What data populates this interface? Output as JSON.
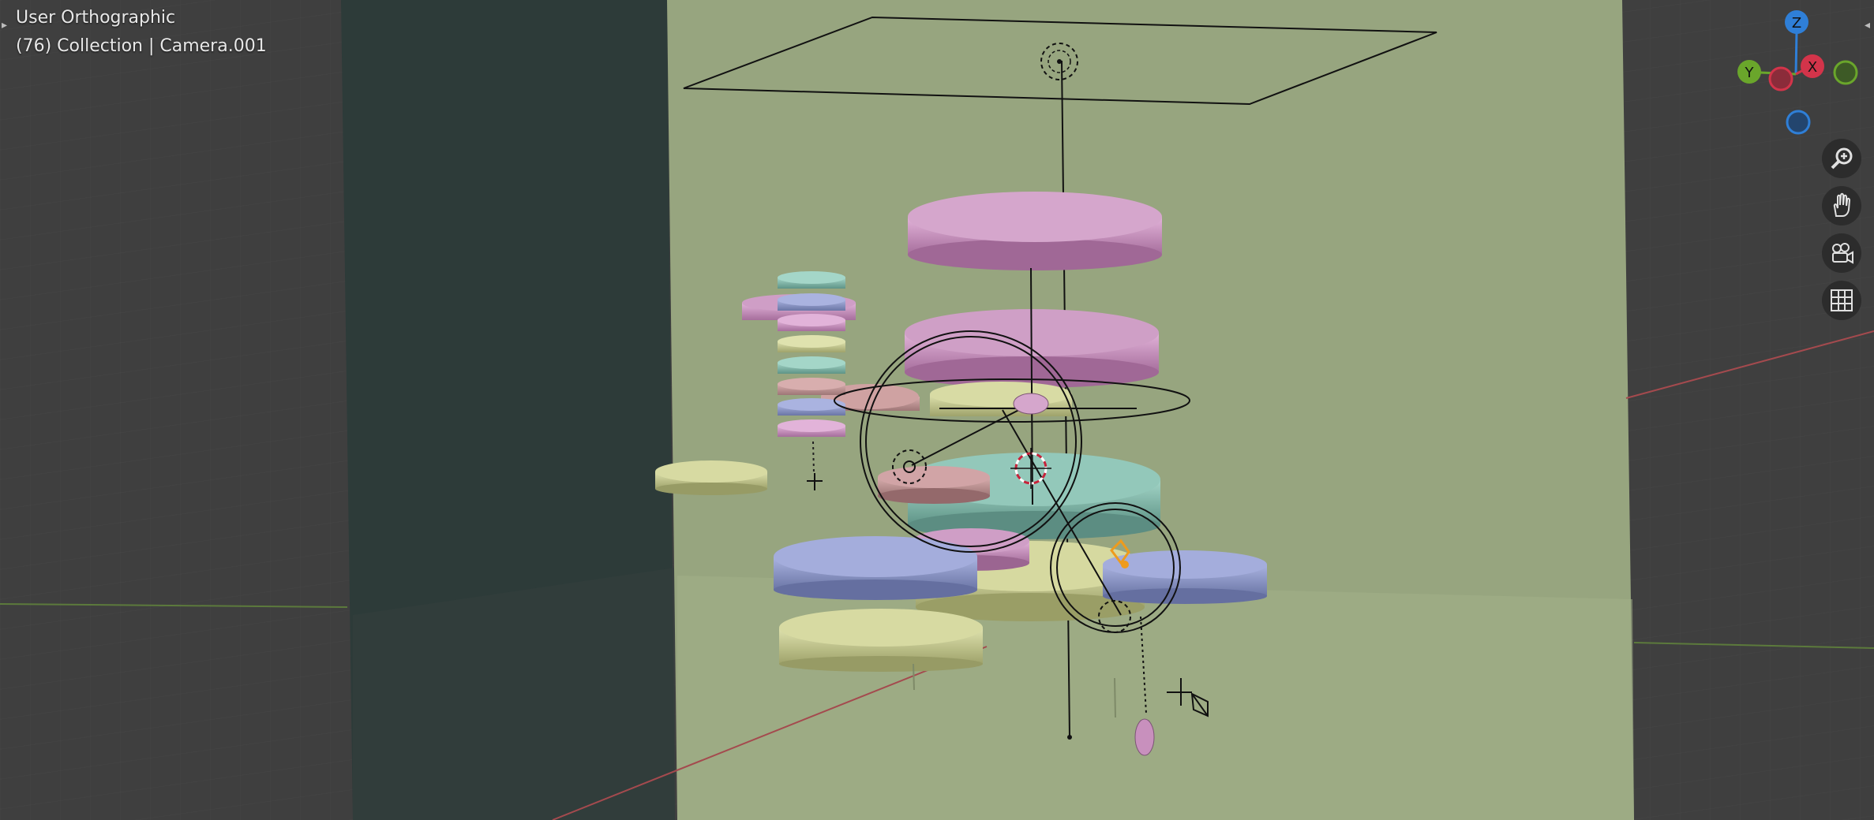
{
  "viewport": {
    "view_name": "User Orthographic",
    "collection_info": "(76) Collection | Camera.001"
  },
  "gizmo": {
    "axes": [
      {
        "label": "Z",
        "color": "#2f7fd7"
      },
      {
        "label": "Y",
        "color": "#6aa62b"
      },
      {
        "label": "X",
        "color": "#d3344a"
      }
    ]
  },
  "nav_buttons": [
    {
      "name": "zoom-button",
      "icon": "magnifier-plus-icon"
    },
    {
      "name": "pan-button",
      "icon": "hand-icon"
    },
    {
      "name": "camera-view-button",
      "icon": "camera-icon"
    },
    {
      "name": "toggle-perspective-button",
      "icon": "grid-icon"
    }
  ],
  "colors": {
    "viewport_bg": "#3d3d3d",
    "ground_plane": "#97a57f",
    "dark_wall": "#2d3b39",
    "disc_pink": "#c890bd",
    "disc_teal": "#7ab5a8",
    "disc_blue": "#8b96c6",
    "disc_yellow": "#c8cc90",
    "selection_orange": "#ee9b1d"
  }
}
